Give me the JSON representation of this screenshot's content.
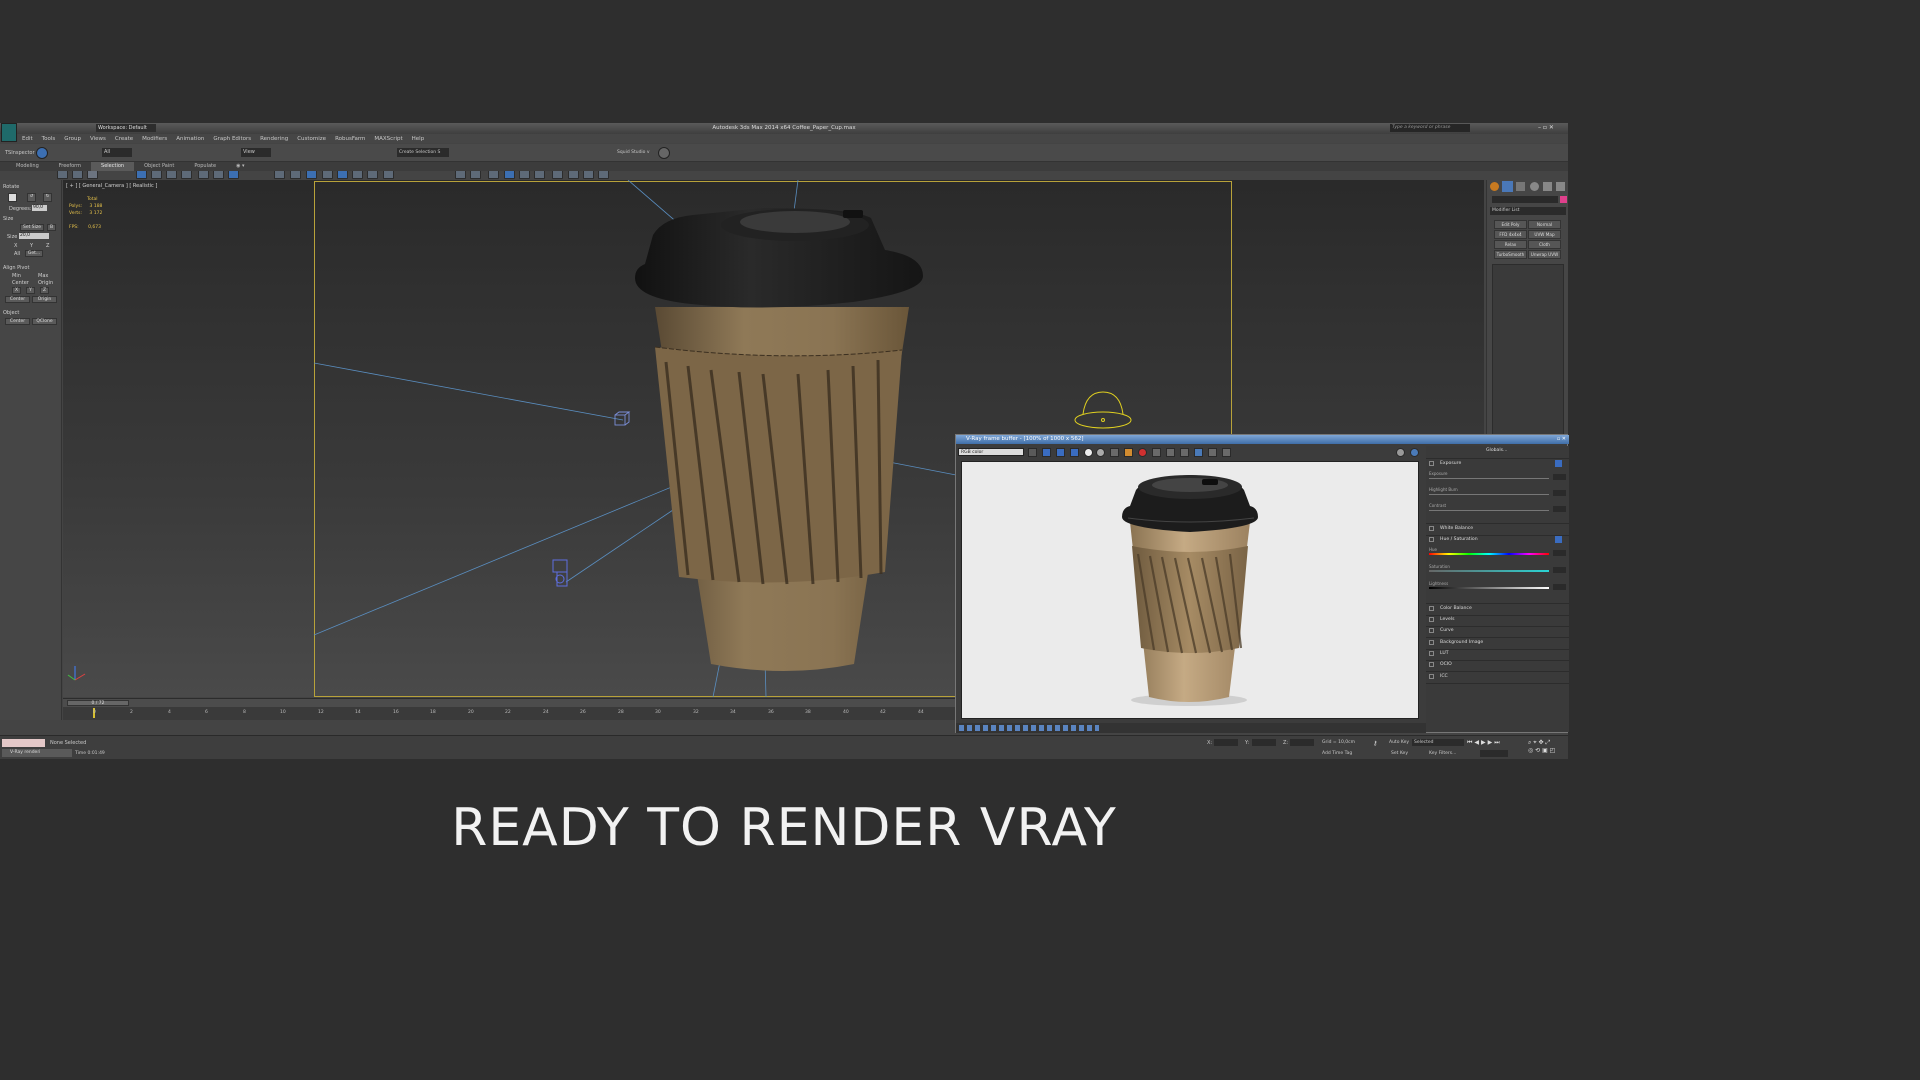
{
  "app": {
    "title": "Autodesk 3ds Max  2014 x64     Coffee_Paper_Cup.max",
    "workspace": "Workspace: Default",
    "search_placeholder": "Type a keyword or phrase"
  },
  "menu": [
    "Edit",
    "Tools",
    "Group",
    "Views",
    "Create",
    "Modifiers",
    "Animation",
    "Graph Editors",
    "Rendering",
    "Customize",
    "RobusFarm",
    "MAXScript",
    "Help"
  ],
  "toolbar": {
    "inspector_label": "TSInspector",
    "filter_value": "All",
    "view_value": "View",
    "selection_set": "Create Selection S",
    "squid_label": "Squid Studio v"
  },
  "ribbon_tabs": [
    "Modeling",
    "Freeform",
    "Selection",
    "Object Paint",
    "Populate"
  ],
  "ribbon_active": "Selection",
  "left_panel": {
    "rotate": "Rotate",
    "degrees_label": "Degrees:",
    "degrees_value": "90,0",
    "size": "Size",
    "set_size": "Set Size",
    "size_label": "Size",
    "size_value": "20,0",
    "x": "X",
    "y": "Y",
    "z": "Z",
    "all": "All",
    "get": "Get...",
    "align_pivot": "Align Pivot",
    "min": "Min",
    "max": "Max",
    "center": "Center",
    "origin": "Origin",
    "center_btn": "Center",
    "origin_btn": "Origin",
    "object": "Object",
    "center_obj": "Center",
    "qclone": "QClone"
  },
  "viewport": {
    "label": "[ + ] [ General_Camera ] [ Realistic ]",
    "total": "Total",
    "polys_label": "Polys:",
    "polys_value": "3 188",
    "verts_label": "Verts:",
    "verts_value": "3 172",
    "fps_label": "FPS:",
    "fps_value": "0,673"
  },
  "timeline": {
    "frame": "0 / 72",
    "ticks": [
      "0",
      "2",
      "4",
      "6",
      "8",
      "10",
      "12",
      "14",
      "16",
      "18",
      "20",
      "22",
      "24",
      "26",
      "28",
      "30",
      "32",
      "34",
      "36",
      "38",
      "40",
      "42",
      "44"
    ]
  },
  "status": {
    "none_selected": "None Selected",
    "vray_msg": "V-Ray renderi",
    "time": "Time  0:01:49",
    "grid": "Grid = 10,0cm",
    "auto_key": "Auto Key",
    "selected": "Selected",
    "set_key": "Set Key",
    "key_filters": "Key Filters...",
    "add_time_tag": "Add Time Tag",
    "x_label": "X:",
    "y_label": "Y:",
    "z_label": "Z:"
  },
  "command_panel": {
    "modifier_list": "Modifier List",
    "buttons": [
      "Edit Poly",
      "Normal",
      "FFD 4x4x4",
      "UVW Map",
      "Relax",
      "Cloth",
      "TurboSmooth",
      "Unwrap UVW"
    ]
  },
  "vfb": {
    "title": "V-Ray frame buffer - [100% of 1000 x 562]",
    "channel": "RGB color",
    "globals": "Globals...",
    "panels": [
      "Exposure",
      "White Balance",
      "Hue / Saturation",
      "Color Balance",
      "Levels",
      "Curve",
      "Background Image",
      "LUT",
      "OCIO",
      "ICC"
    ],
    "exposure_rows": [
      "Exposure",
      "Highlight Burn",
      "Contrast"
    ],
    "hs_rows": [
      "Hue",
      "Saturation",
      "Lightness"
    ]
  },
  "caption": "READY TO RENDER  VRAY",
  "colors": {
    "accent_blue": "#3f6ea8",
    "safe_frame": "#b8a23a",
    "stats_yellow": "#e6c24a",
    "cup_kraft": "#8c7554",
    "lid_black": "#1e1e1e"
  }
}
